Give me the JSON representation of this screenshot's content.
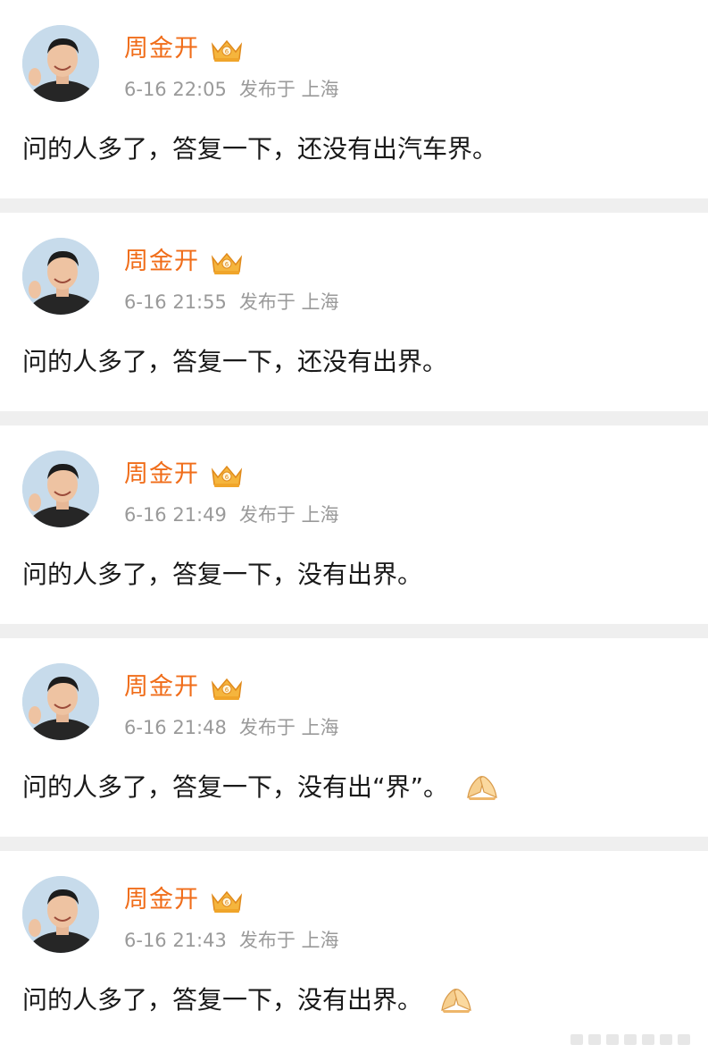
{
  "colors": {
    "username": "#f06d1a",
    "meta": "#9a9a9a",
    "divider": "#efefef",
    "text": "#1a1a1a"
  },
  "icons": {
    "badge": "crown-badge-icon",
    "emoji": "pinched-hands-emoji"
  },
  "posts": [
    {
      "username": "周金开",
      "time": "6-16 22:05",
      "location": "发布于 上海",
      "text": "问的人多了，答复一下，还没有出汽车界。",
      "has_emoji": false
    },
    {
      "username": "周金开",
      "time": "6-16 21:55",
      "location": "发布于 上海",
      "text": "问的人多了，答复一下，还没有出界。",
      "has_emoji": false
    },
    {
      "username": "周金开",
      "time": "6-16 21:49",
      "location": "发布于 上海",
      "text": "问的人多了，答复一下，没有出界。",
      "has_emoji": false
    },
    {
      "username": "周金开",
      "time": "6-16 21:48",
      "location": "发布于 上海",
      "text": "问的人多了，答复一下，没有出“界”。",
      "has_emoji": true
    },
    {
      "username": "周金开",
      "time": "6-16 21:43",
      "location": "发布于 上海",
      "text": "问的人多了，答复一下，没有出界。",
      "has_emoji": true
    }
  ]
}
